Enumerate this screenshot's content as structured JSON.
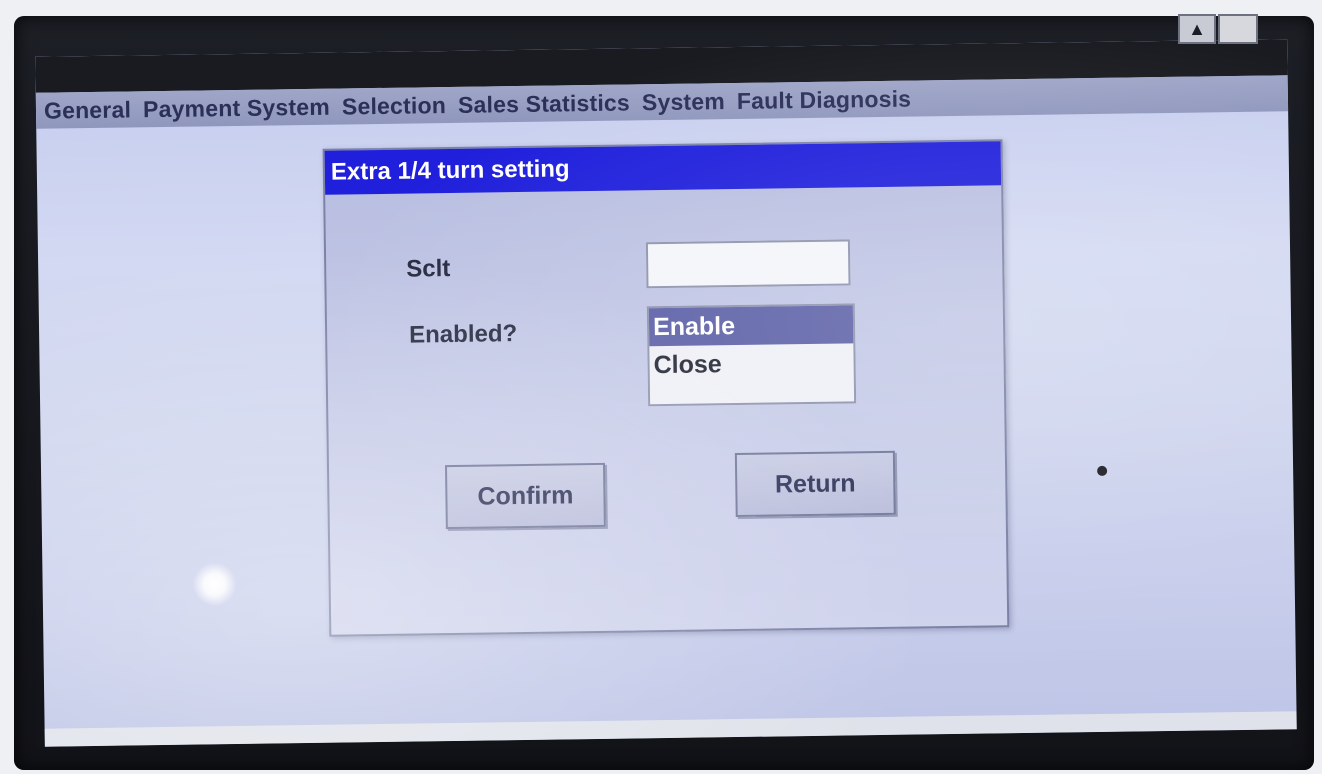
{
  "menubar": {
    "items": [
      {
        "label": "General"
      },
      {
        "label": "Payment System"
      },
      {
        "label": "Selection"
      },
      {
        "label": "Sales Statistics"
      },
      {
        "label": "System"
      },
      {
        "label": "Fault Diagnosis"
      }
    ]
  },
  "scrollbar": {
    "up_glyph": "▲"
  },
  "dialog": {
    "title": "Extra 1/4 turn setting",
    "sclt_label": "Sclt",
    "sclt_value": "",
    "enabled_label": "Enabled?",
    "options": [
      {
        "label": "Enable",
        "selected": true
      },
      {
        "label": "Close",
        "selected": false
      }
    ],
    "confirm_label": "Confirm",
    "return_label": "Return"
  },
  "colors": {
    "title_bar": "#1f1fdc",
    "selected_option": "#5b5fa6",
    "menu_text": "#2b3058"
  }
}
